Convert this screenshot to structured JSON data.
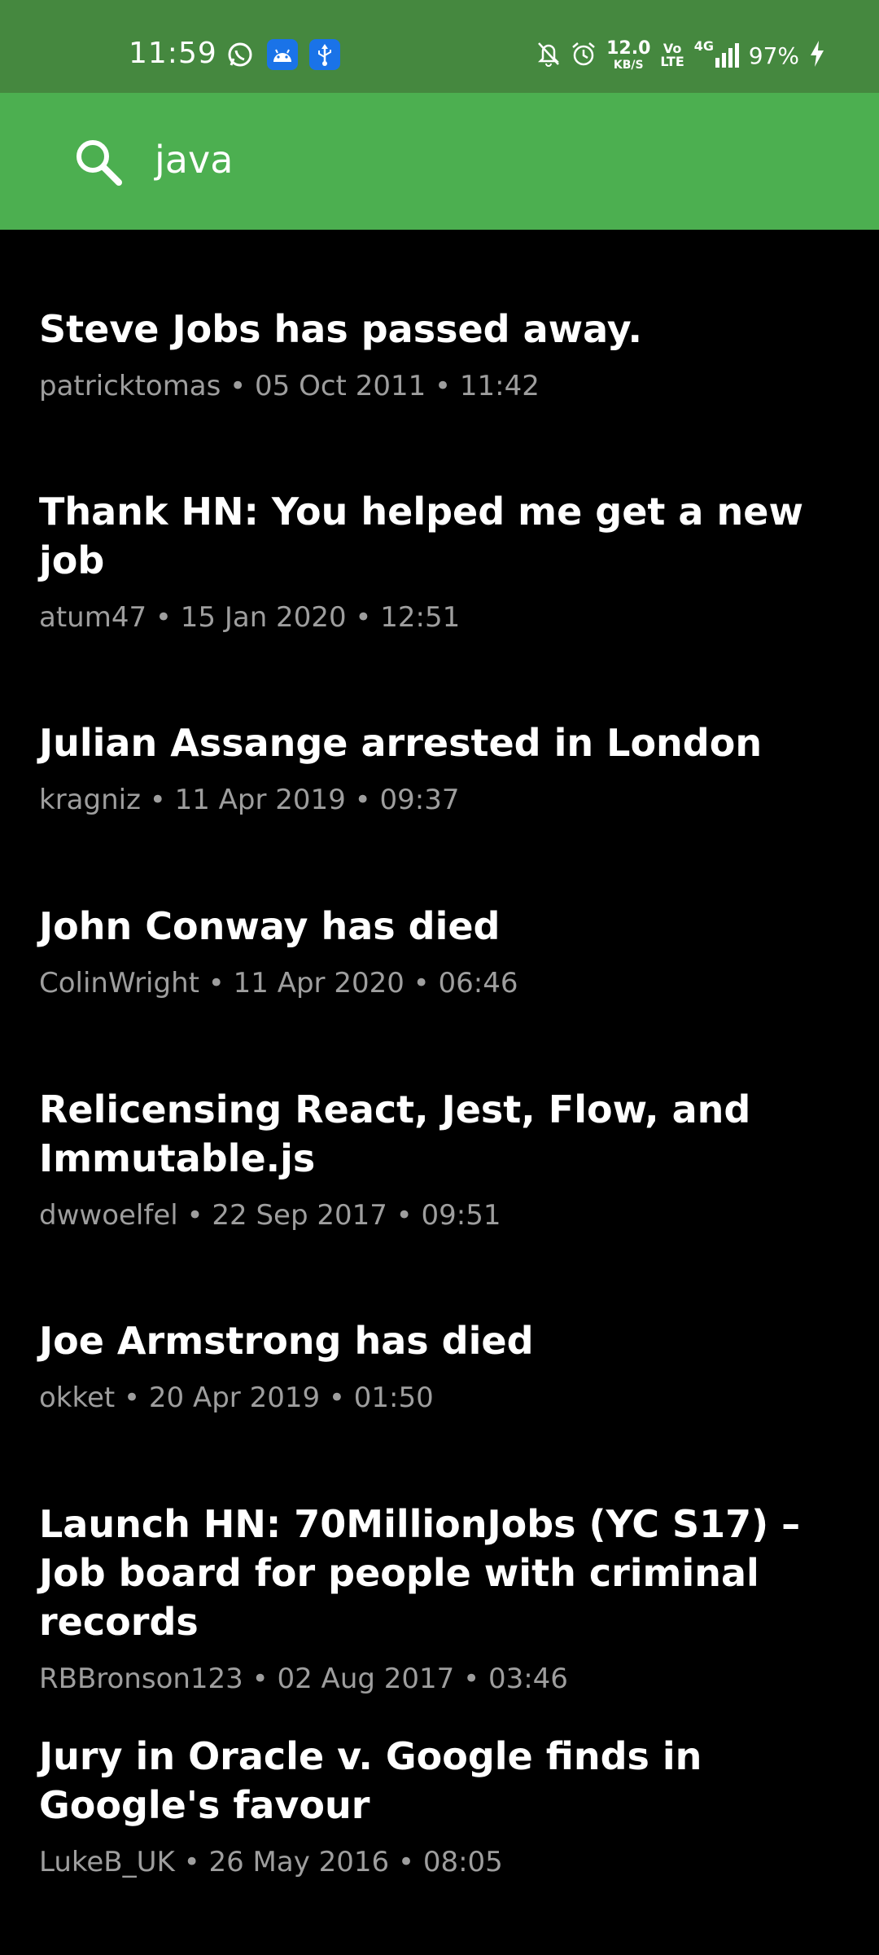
{
  "status_bar": {
    "time": "11:59",
    "speed_value": "12.0",
    "speed_unit": "KB/S",
    "volte_top": "Vo",
    "volte_bottom": "LTE",
    "network": "4G",
    "battery": "97%",
    "icons": [
      "whatsapp-icon",
      "android-icon",
      "usb-icon",
      "mute-bell-icon",
      "alarm-icon",
      "signal-icon",
      "charging-icon"
    ]
  },
  "search": {
    "query": "java"
  },
  "results": [
    {
      "title": "Steve Jobs has passed away.",
      "meta": "patricktomas • 05 Oct 2011 • 11:42"
    },
    {
      "title": "Thank HN: You helped me get a new job",
      "meta": "atum47 • 15 Jan 2020 • 12:51"
    },
    {
      "title": "Julian Assange arrested in London",
      "meta": "kragniz • 11 Apr 2019 • 09:37"
    },
    {
      "title": "John Conway has died",
      "meta": "ColinWright • 11 Apr 2020 • 06:46"
    },
    {
      "title": "Relicensing React, Jest, Flow, and Immutable.js",
      "meta": "dwwoelfel • 22 Sep 2017 • 09:51"
    },
    {
      "title": "Joe Armstrong has died",
      "meta": "okket • 20 Apr 2019 • 01:50"
    },
    {
      "title": "Launch HN: 70MillionJobs (YC S17) – Job board for people with criminal records",
      "meta": "RBBronson123 • 02 Aug 2017 • 03:46"
    },
    {
      "title": "Jury in Oracle v. Google finds in Google's favour",
      "meta": "LukeB_UK • 26 May 2016 • 08:05"
    }
  ],
  "colors": {
    "status_bar": "#45883f",
    "search_bar": "#4caf50",
    "background": "#000000",
    "title": "#ffffff",
    "meta": "#9e9e9e"
  }
}
